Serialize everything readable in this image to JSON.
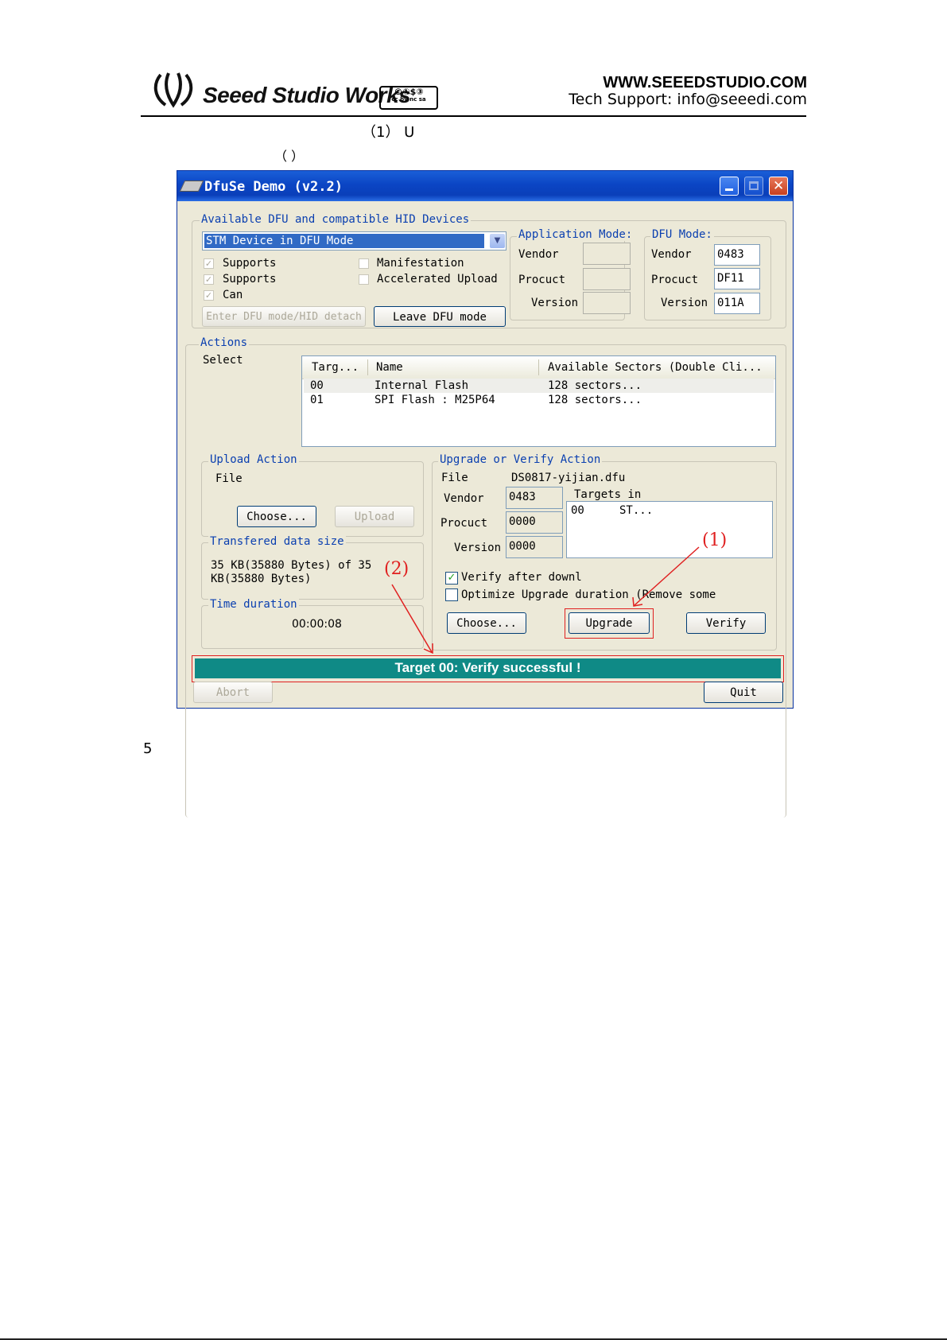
{
  "page": {
    "brand": "Seeed Studio Works",
    "license_badge": "cc by nc sa",
    "website": "WWW.SEEEDSTUDIO.COM",
    "support": "Tech Support: info@seeedi.com",
    "step_heading": "（1） U",
    "paren": "（  ）",
    "section_number": "5"
  },
  "window": {
    "title": "DfuSe Demo (v2.2)",
    "devices_group": "Available DFU and compatible HID Devices",
    "device_selected": "STM Device in DFU Mode",
    "checks": [
      {
        "label": "Supports",
        "checked": true,
        "enabled": false
      },
      {
        "label": "Supports",
        "checked": true,
        "enabled": false
      },
      {
        "label": "Can",
        "checked": true,
        "enabled": false
      },
      {
        "label": "Manifestation",
        "checked": false,
        "enabled": true
      },
      {
        "label": "Accelerated Upload",
        "checked": false,
        "enabled": true
      }
    ],
    "enter_dfu_button": "Enter DFU mode/HID detach",
    "leave_dfu_button": "Leave DFU mode",
    "app_mode": {
      "label": "Application Mode:",
      "vendor_label": "Vendor",
      "product_label": "Procuct",
      "version_label": "Version",
      "vendor": "",
      "product": "",
      "version": ""
    },
    "dfu_mode": {
      "label": "DFU Mode:",
      "vendor_label": "Vendor",
      "product_label": "Procuct",
      "version_label": "Version",
      "vendor": "0483",
      "product": "DF11",
      "version": "011A"
    },
    "actions": {
      "label": "Actions",
      "select_label": "Select",
      "columns": [
        "Targ...",
        "Name",
        "Available Sectors (Double Cli..."
      ],
      "rows": [
        {
          "target": "00",
          "name": "Internal Flash",
          "sectors": "128 sectors..."
        },
        {
          "target": "01",
          "name": "SPI Flash : M25P64",
          "sectors": "128 sectors..."
        }
      ]
    },
    "upload": {
      "label": "Upload Action",
      "file_label": "File",
      "choose": "Choose...",
      "upload": "Upload"
    },
    "transfer": {
      "label": "Transfered data size",
      "line1": "35 KB(35880 Bytes) of 35",
      "line2": "KB(35880 Bytes)"
    },
    "time": {
      "label": "Time duration",
      "value": "00:00:08"
    },
    "upgrade": {
      "label": "Upgrade or Verify Action",
      "file_label": "File",
      "file_value": "DS0817-yijian.dfu",
      "vendor_label": "Vendor",
      "vendor": "0483",
      "product_label": "Procuct",
      "product": "0000",
      "version_label": "Version",
      "version": "0000",
      "targets_label": "Targets in",
      "targets": [
        {
          "id": "00",
          "name": "ST..."
        }
      ],
      "verify_after": "Verify after downl",
      "verify_after_checked": true,
      "optimize": "Optimize Upgrade duration (Remove some",
      "optimize_checked": false,
      "choose": "Choose...",
      "upgrade": "Upgrade",
      "verify": "Verify"
    },
    "status": "Target 00: Verify successful !",
    "abort": "Abort",
    "quit": "Quit"
  },
  "annotations": {
    "one": "(1)",
    "two": "(2)",
    "color": "#e02020"
  },
  "colors": {
    "titlebar": "#0b45c4",
    "status_bar": "#0f8a86",
    "window_bg": "#ece9d8",
    "group_label": "#0a3fb0"
  }
}
